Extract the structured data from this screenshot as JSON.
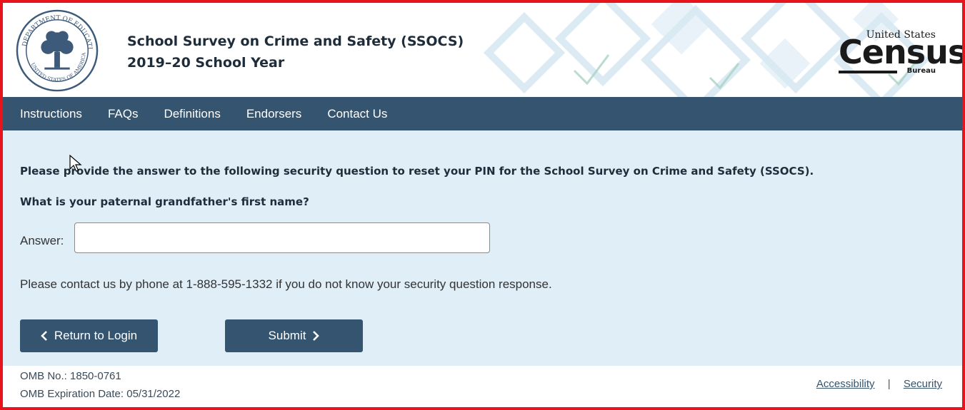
{
  "header": {
    "title_line1": "School Survey on Crime and Safety (SSOCS)",
    "title_line2": "2019–20 School Year",
    "seal_alt": "Department of Education seal",
    "seal_text_top": "DEPARTMENT OF EDUCATION",
    "seal_text_bottom": "UNITED STATES OF AMERICA",
    "census_top": "United States",
    "census_big": "Census",
    "census_bureau": "Bureau"
  },
  "nav": {
    "items": [
      "Instructions",
      "FAQs",
      "Definitions",
      "Endorsers",
      "Contact Us"
    ]
  },
  "main": {
    "intro": "Please provide the answer to the following security question to reset your PIN for the School Survey on Crime and Safety (SSOCS).",
    "question": "What is your paternal grandfather's first name?",
    "answer_label": "Answer:",
    "answer_value": "",
    "contact_text": "Please contact us by phone at 1-888-595-1332 if you do not know your security question response.",
    "return_button": "Return to Login",
    "submit_button": "Submit"
  },
  "footer": {
    "omb_no": "OMB No.: 1850-0761",
    "omb_expiration": "OMB Expiration Date: 05/31/2022",
    "link_accessibility": "Accessibility",
    "separator": "|",
    "link_security": "Security"
  },
  "colors": {
    "frame_border": "#e8141b",
    "nav_bg": "#35546f",
    "main_bg": "#e0eef8",
    "button_bg": "#35546f"
  }
}
